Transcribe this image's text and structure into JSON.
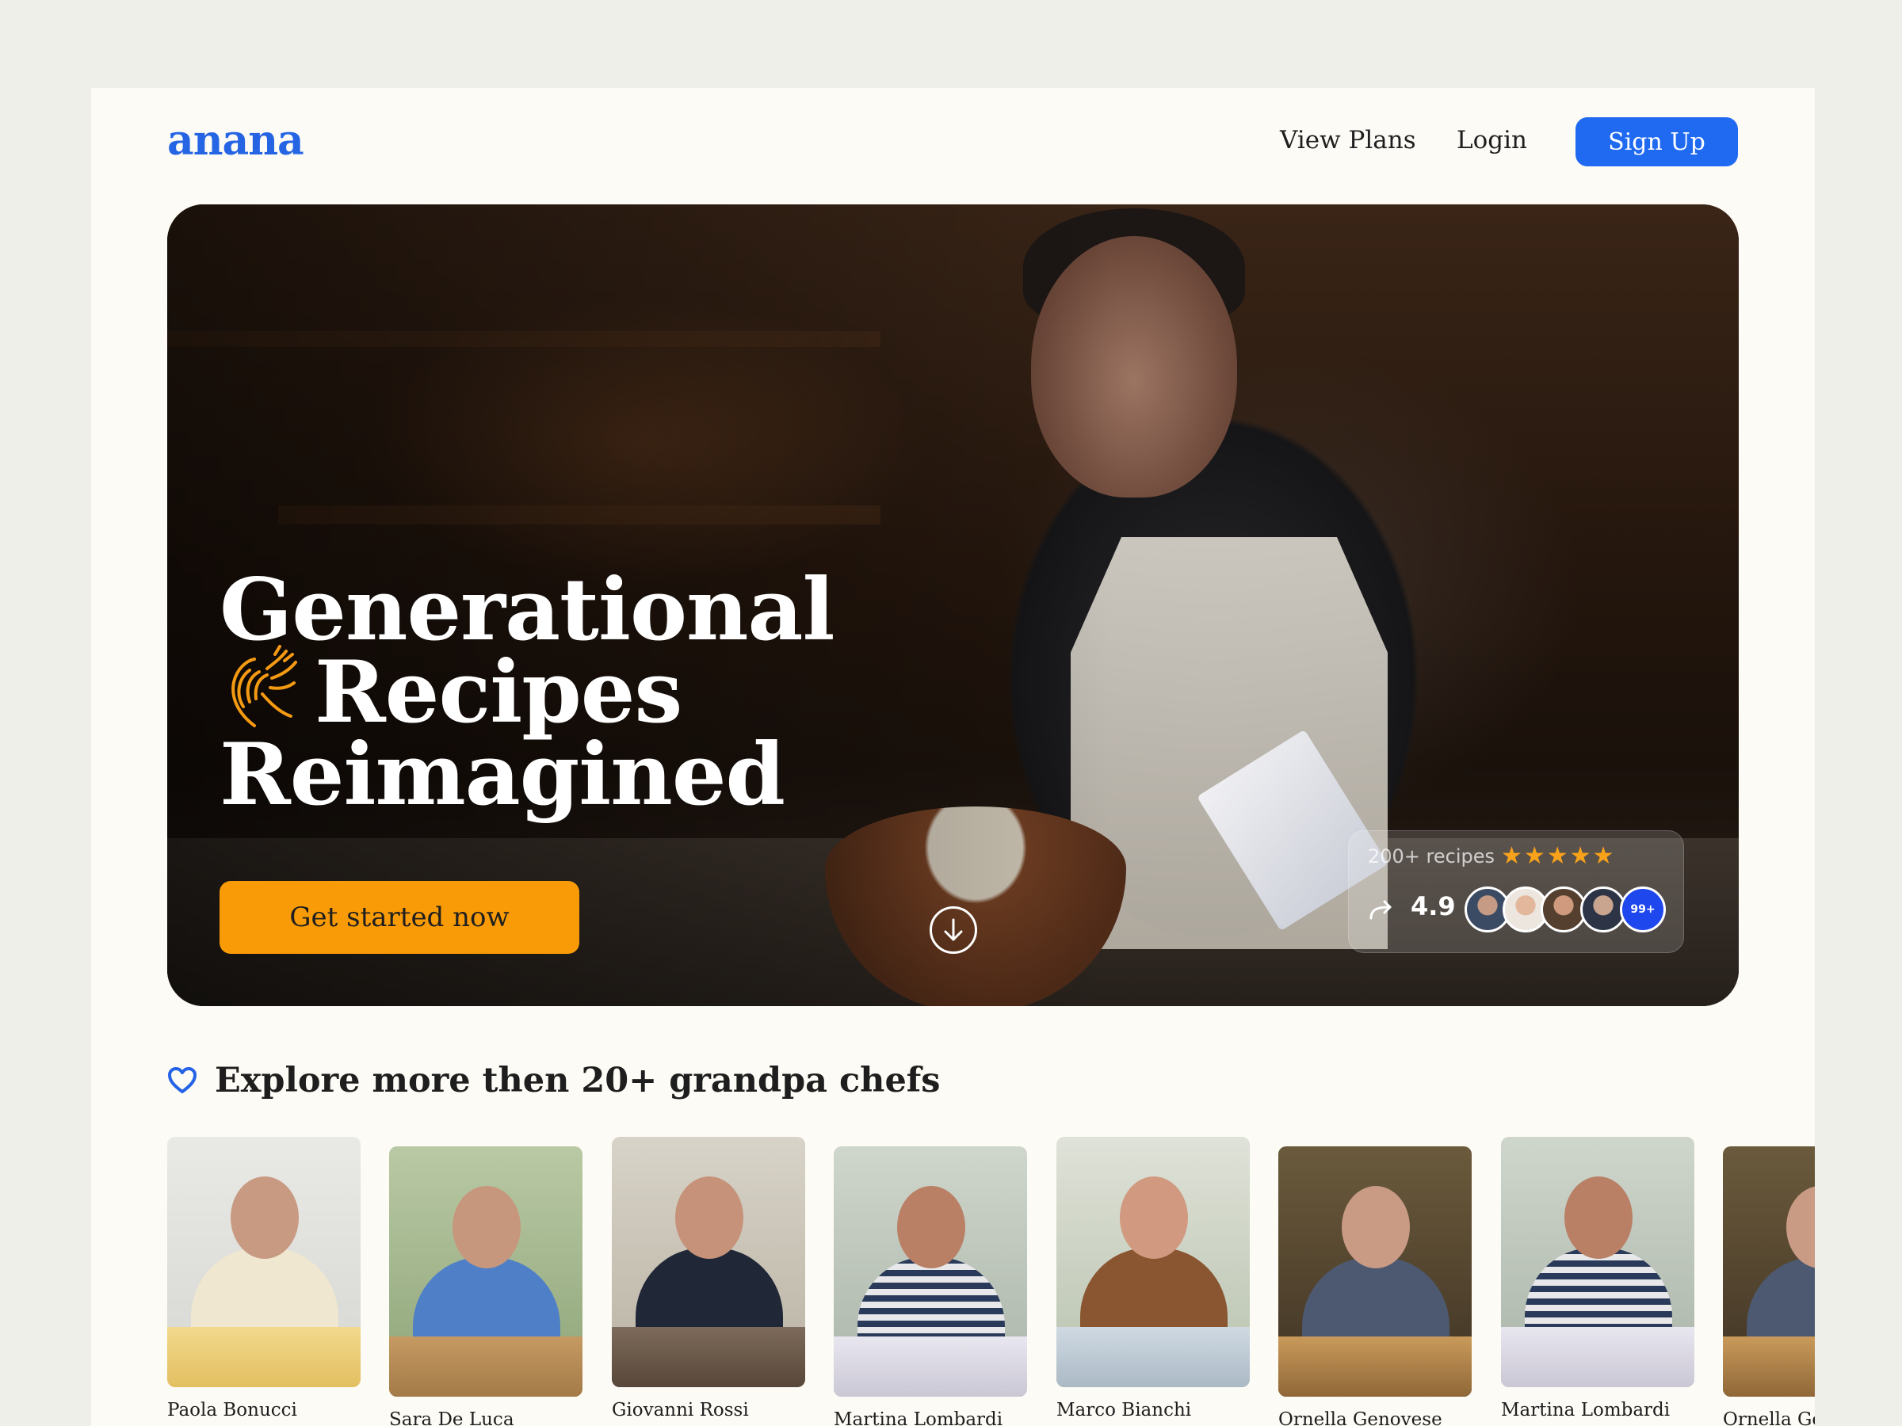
{
  "header": {
    "logo": "anana",
    "nav": {
      "view_plans": "View Plans",
      "login": "Login"
    },
    "signup_label": "Sign Up"
  },
  "hero": {
    "title_lines": [
      "Generational",
      "Recipes",
      "Reimagined"
    ],
    "cta_label": "Get started now",
    "rating": {
      "recipes_label": "200+ recipes",
      "stars": "★★★★★",
      "score": "4.9",
      "more_badge": "99+"
    }
  },
  "explore": {
    "title": "Explore more then 20+ grandpa chefs",
    "chefs": [
      {
        "name": "Paola Bonucci"
      },
      {
        "name": "Sara De Luca"
      },
      {
        "name": "Giovanni Rossi"
      },
      {
        "name": "Martina Lombardi"
      },
      {
        "name": "Marco Bianchi"
      },
      {
        "name": "Ornella Genovese"
      },
      {
        "name": "Martina Lombardi"
      },
      {
        "name": "Ornella Genovese"
      }
    ]
  },
  "colors": {
    "brand": "#2565e4",
    "signup": "#1f6af1",
    "cta": "#f99b06",
    "star": "#f8a21b",
    "badge": "#1f47ee"
  },
  "icons": [
    "hand-drawn-hands-icon",
    "arrow-down-circle-icon",
    "share-arrow-icon",
    "heart-icon"
  ]
}
